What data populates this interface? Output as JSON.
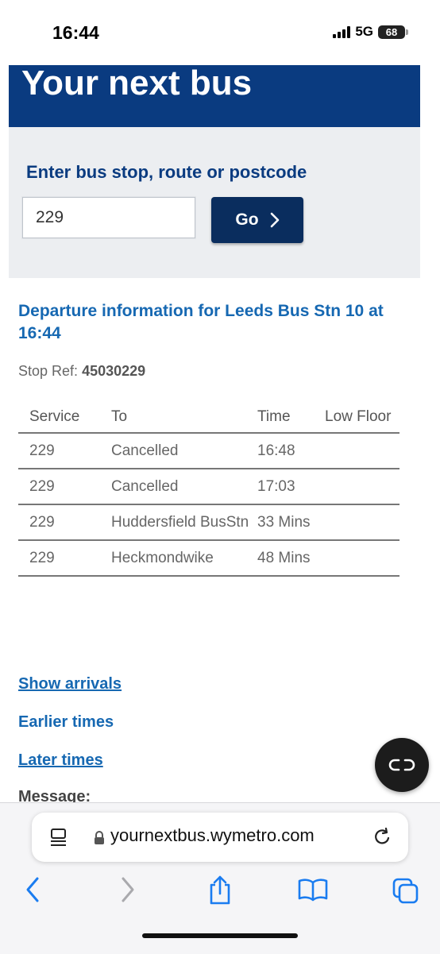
{
  "status": {
    "time": "16:44",
    "network": "5G",
    "battery": "68"
  },
  "header": {
    "title": "Your next bus"
  },
  "search": {
    "label": "Enter bus stop, route or postcode",
    "value": "229",
    "go_label": "Go"
  },
  "departures": {
    "title": "Departure information for Leeds Bus Stn 10 at 16:44",
    "stop_ref_label": "Stop Ref:",
    "stop_ref_value": "45030229",
    "columns": [
      "Service",
      "To",
      "Time",
      "Low Floor"
    ],
    "rows": [
      {
        "service": "229",
        "to": "Cancelled",
        "time": "16:48",
        "low_floor": ""
      },
      {
        "service": "229",
        "to": "Cancelled",
        "time": "17:03",
        "low_floor": ""
      },
      {
        "service": "229",
        "to": "Huddersfield BusStn",
        "time": "33 Mins",
        "low_floor": ""
      },
      {
        "service": "229",
        "to": "Heckmondwike",
        "time": "48 Mins",
        "low_floor": ""
      }
    ]
  },
  "links": {
    "show_arrivals": "Show arrivals",
    "earlier_times": "Earlier times",
    "later_times": "Later times"
  },
  "message_label": "Message:",
  "browser": {
    "url": "yournextbus.wymetro.com"
  },
  "colors": {
    "header_bg": "#0a3b80",
    "button_bg": "#0a2d5e",
    "link": "#1668b2",
    "panel_bg": "#eceef1",
    "ios_blue": "#1a7cf0"
  }
}
